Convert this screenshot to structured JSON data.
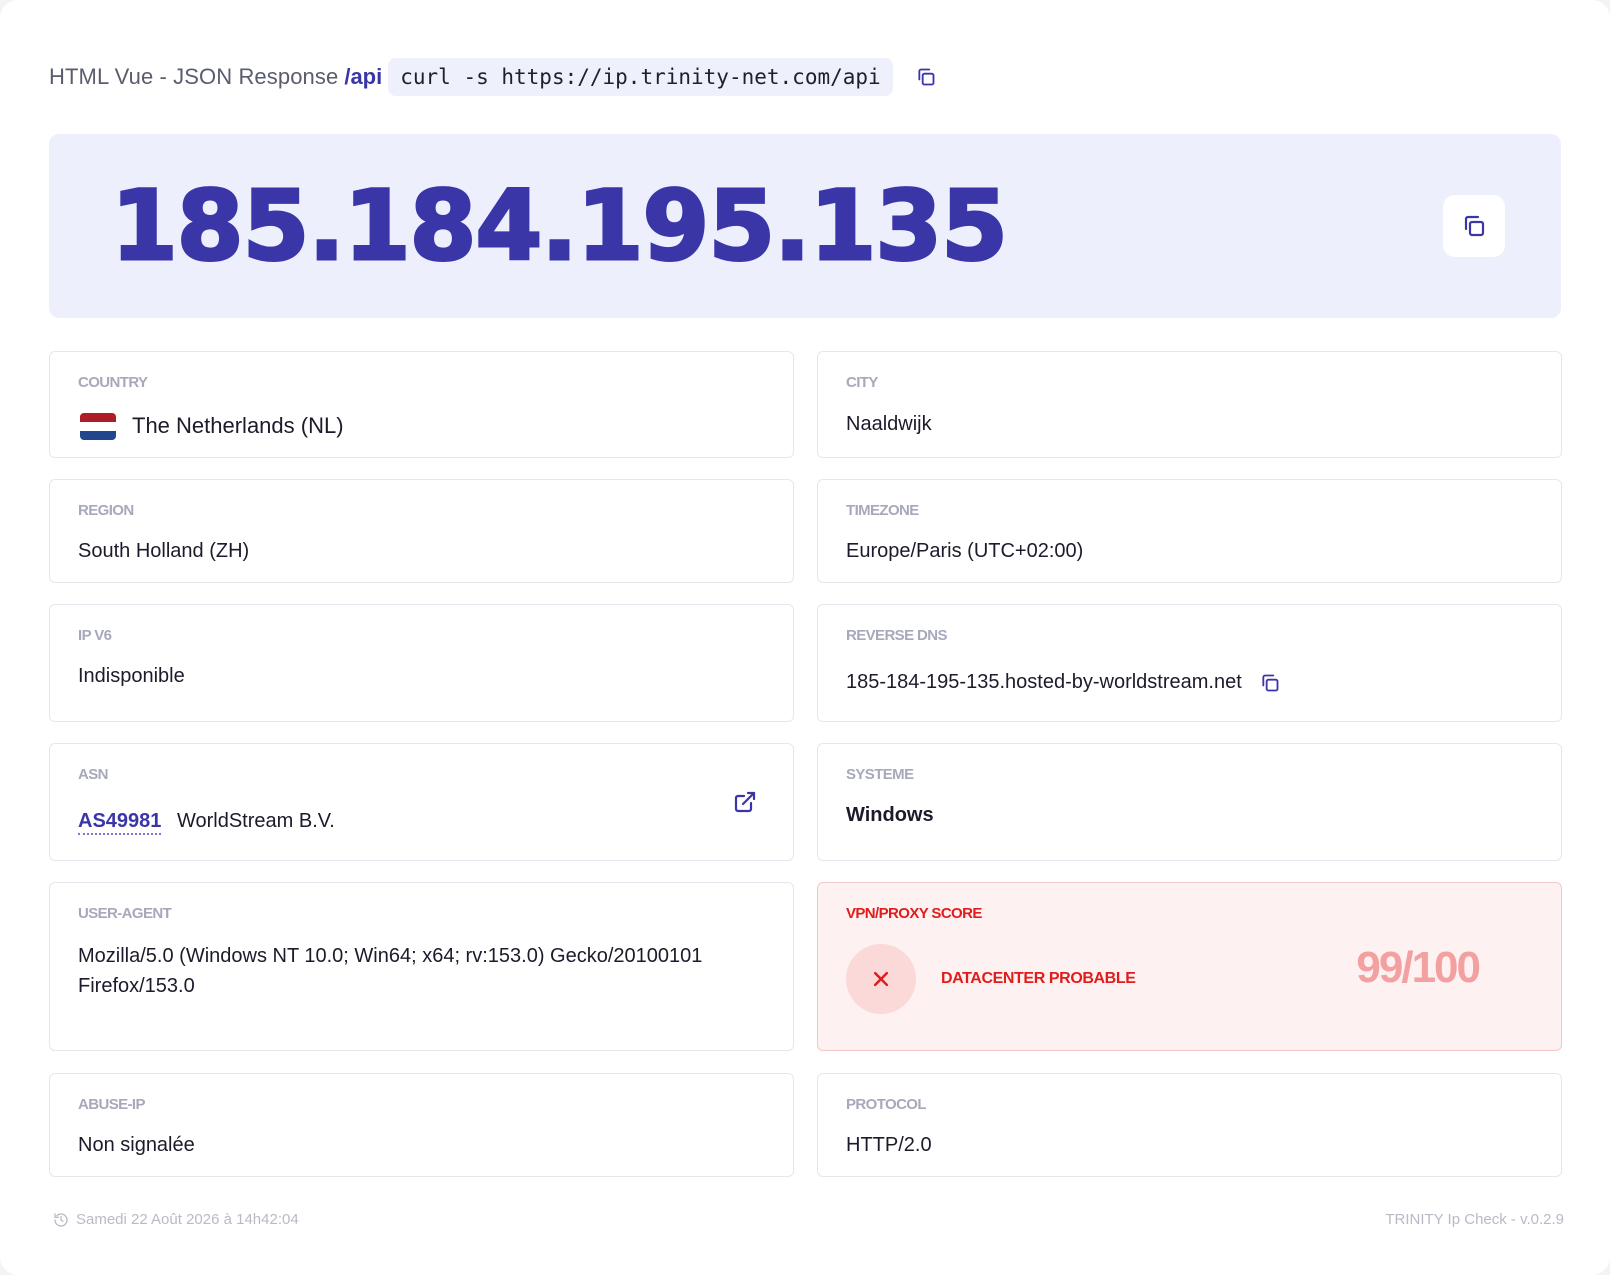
{
  "header": {
    "links_text": "HTML Vue - JSON Response",
    "api_label": "/api",
    "curl_command": "curl -s https://ip.trinity-net.com/api",
    "copy_icon": "copy-icon"
  },
  "ip": {
    "address": "185.184.195.135",
    "copy_icon": "copy-icon"
  },
  "country": {
    "label": "COUNTRY",
    "value": "The Netherlands (NL)",
    "flag_colors": [
      "#ae1c28",
      "#ffffff",
      "#21468b"
    ]
  },
  "city": {
    "label": "CITY",
    "value": "Naaldwijk"
  },
  "region": {
    "label": "REGION",
    "value": "South Holland (ZH)"
  },
  "timezone": {
    "label": "TIMEZONE",
    "value": "Europe/Paris (UTC+02:00)"
  },
  "ipv6": {
    "label": "IP V6",
    "value": "Indisponible"
  },
  "reverse_dns": {
    "label": "REVERSE DNS",
    "value": "185-184-195-135.hosted-by-worldstream.net",
    "copy_icon": "copy-icon"
  },
  "asn": {
    "label": "ASN",
    "number": "AS49981",
    "org": "WorldStream B.V.",
    "icon": "external-link-icon"
  },
  "system": {
    "label": "SYSTEME",
    "value": "Windows"
  },
  "user_agent": {
    "label": "USER-AGENT",
    "line1": "Mozilla/5.0 (Windows NT 10.0; Win64; x64; rv:153.0) Gecko/20100101",
    "line2": "Firefox/153.0"
  },
  "vpn": {
    "label": "VPN/PROXY SCORE",
    "status": "DATACENTER PROBABLE",
    "score": "99/100",
    "icon": "x-icon"
  },
  "abuse": {
    "label": "ABUSE-IP",
    "value": "Non signalée"
  },
  "protocol": {
    "label": "PROTOCOL",
    "value": "HTTP/2.0"
  },
  "footer": {
    "timestamp": "Samedi 22 Août 2026 à 14h42:04",
    "version": "TRINITY Ip Check - v.0.2.9",
    "icon": "history-icon"
  },
  "colors": {
    "accent": "#3b36a8",
    "danger": "#e01d1d",
    "hero_bg": "#eeeffd"
  }
}
